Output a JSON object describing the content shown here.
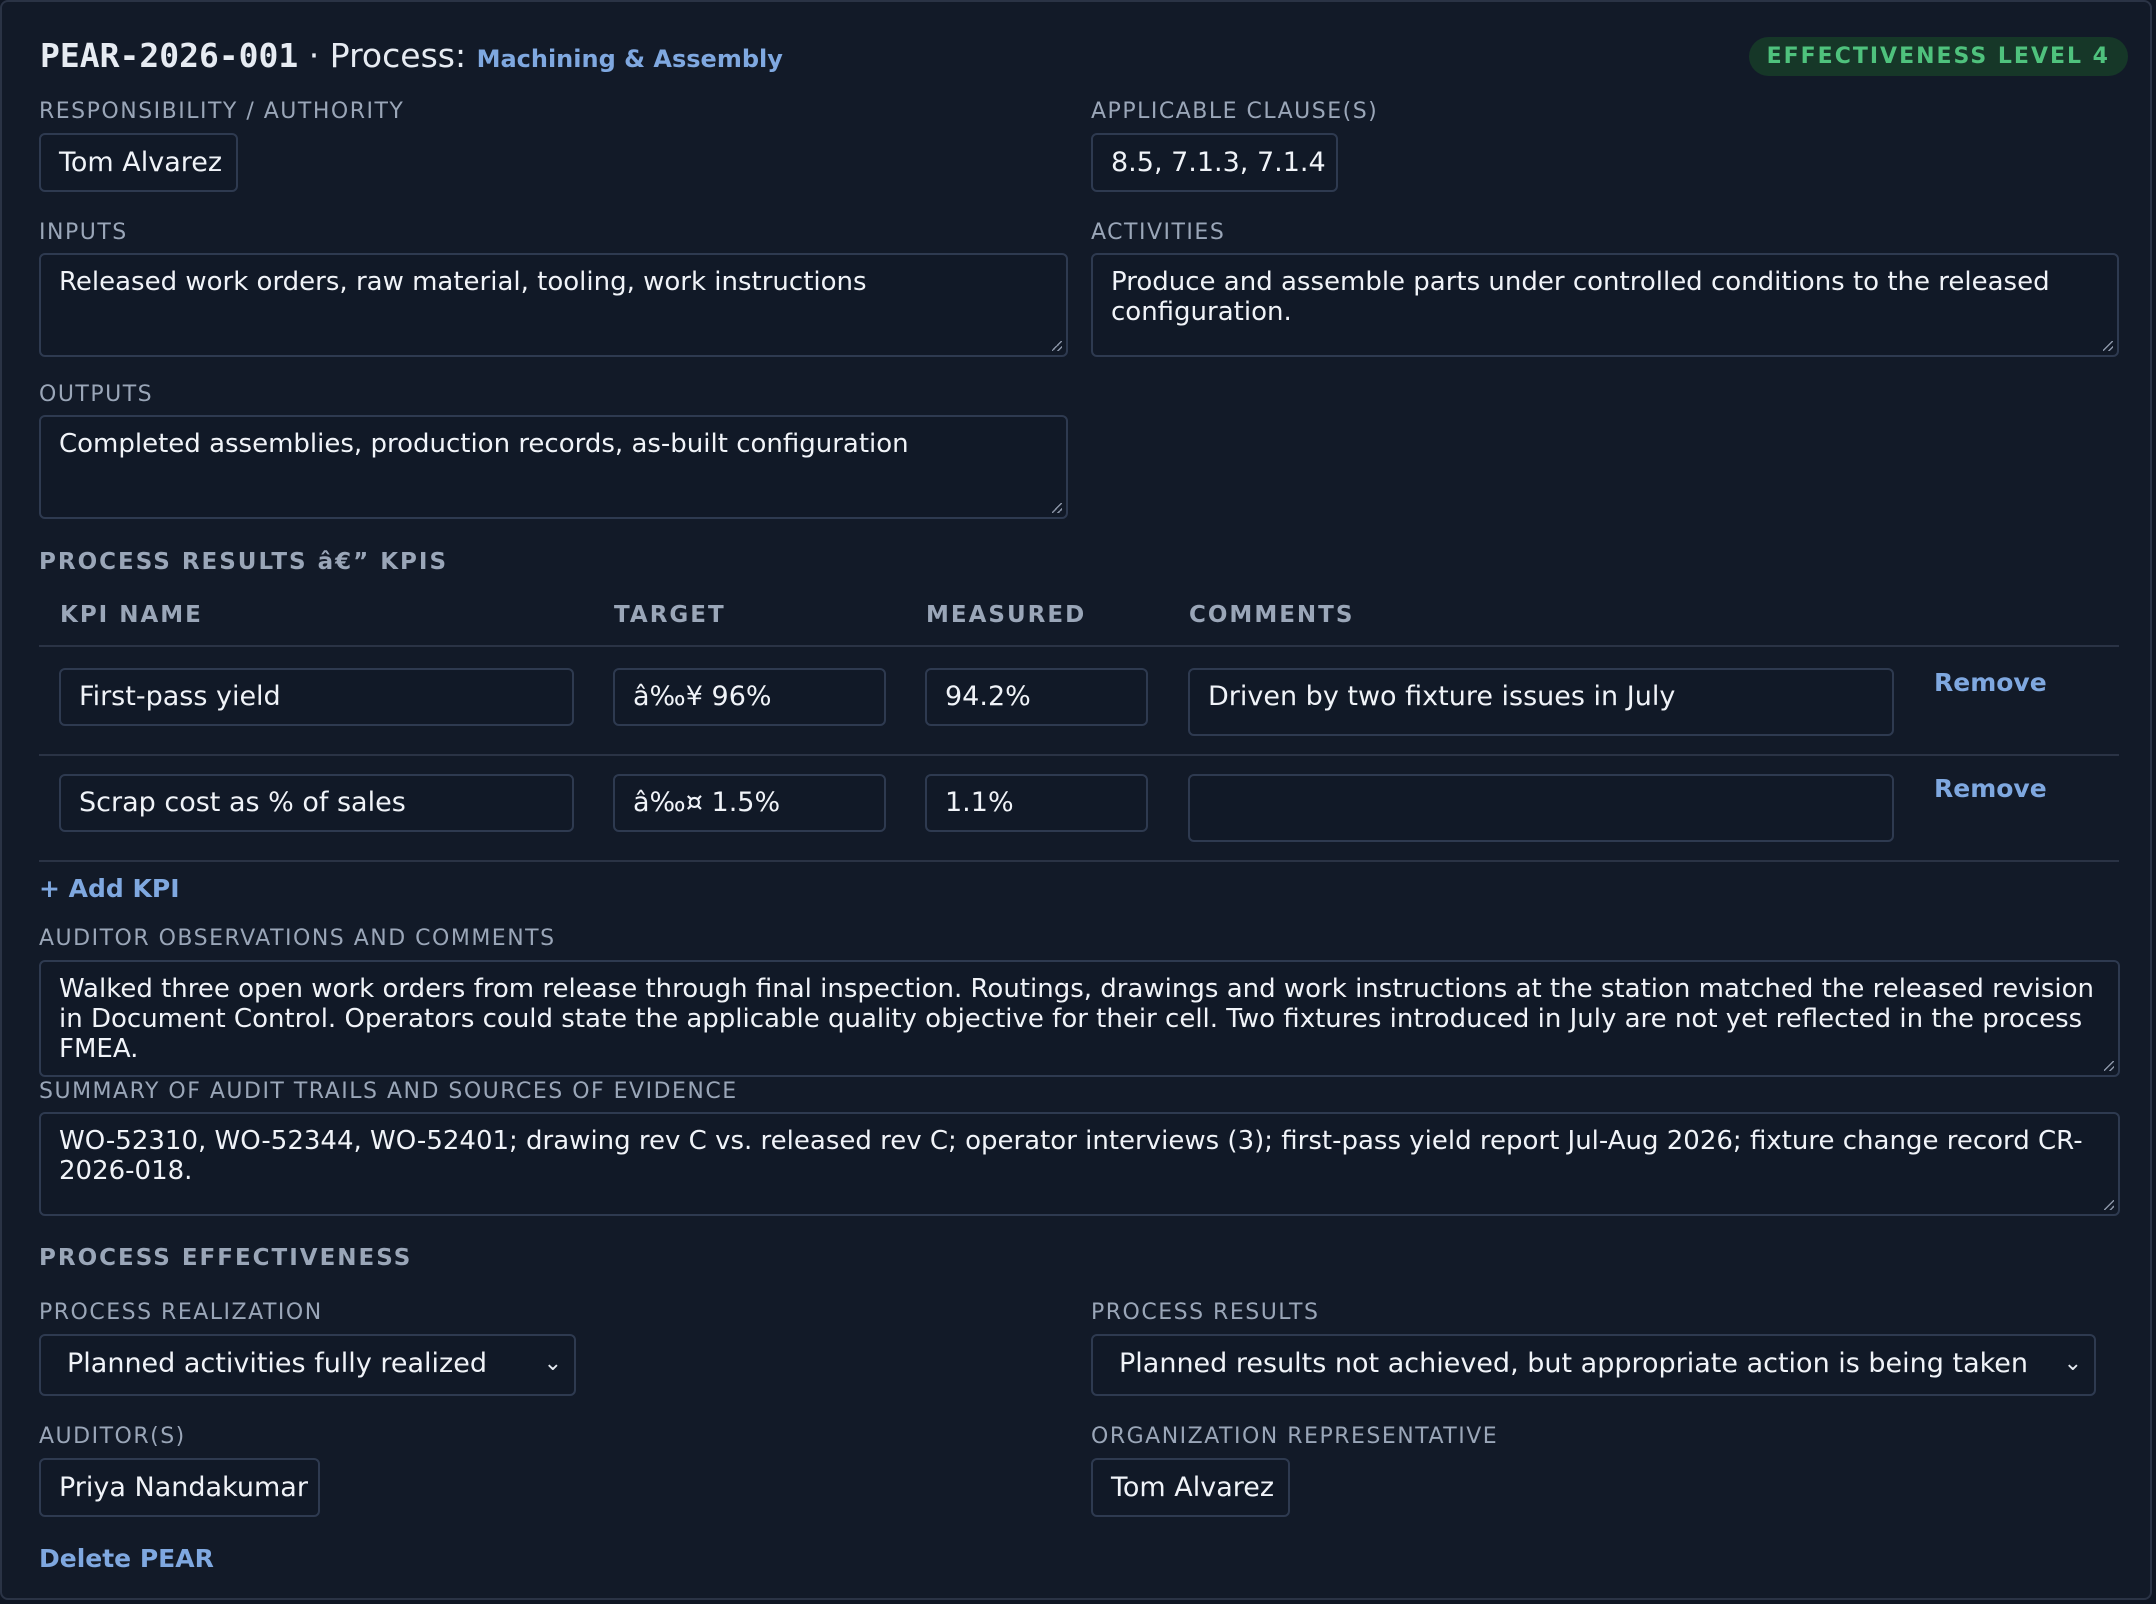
{
  "header": {
    "pear_id": "PEAR-2026-001",
    "separator": " · ",
    "process_prefix": "Process: ",
    "process_name": "Machining & Assembly",
    "badge": "EFFECTIVENESS LEVEL 4"
  },
  "fields": {
    "responsibility_label": "RESPONSIBILITY / AUTHORITY",
    "responsibility_value": "Tom Alvarez",
    "clauses_label": "APPLICABLE CLAUSE(S)",
    "clauses_value": "8.5, 7.1.3, 7.1.4",
    "inputs_label": "INPUTS",
    "inputs_value": "Released work orders, raw material, tooling, work instructions",
    "activities_label": "ACTIVITIES",
    "activities_value": "Produce and assemble parts under controlled conditions to the released configuration.",
    "outputs_label": "OUTPUTS",
    "outputs_value": "Completed assemblies, production records, as-built configuration"
  },
  "kpis": {
    "section_title": "PROCESS RESULTS â€” KPIS",
    "columns": [
      "KPI NAME",
      "TARGET",
      "MEASURED",
      "COMMENTS"
    ],
    "rows": [
      {
        "name": "First-pass yield",
        "target": "â‰¥ 96%",
        "measured": "94.2%",
        "comments": "Driven by two fixture issues in July",
        "remove": "Remove"
      },
      {
        "name": "Scrap cost as % of sales",
        "target": "â‰¤ 1.5%",
        "measured": "1.1%",
        "comments": "",
        "remove": "Remove"
      }
    ],
    "add_label": "+ Add KPI"
  },
  "observations": {
    "label": "AUDITOR OBSERVATIONS AND COMMENTS",
    "value": "Walked three open work orders from release through final inspection. Routings, drawings and work instructions at the station matched the released revision in Document Control. Operators could state the applicable quality objective for their cell. Two fixtures introduced in July are not yet reflected in the process FMEA."
  },
  "evidence": {
    "label": "SUMMARY OF AUDIT TRAILS AND SOURCES OF EVIDENCE",
    "value": "WO-52310, WO-52344, WO-52401; drawing rev C vs. released rev C; operator interviews (3); first-pass yield report Jul-Aug 2026; fixture change record CR-2026-018."
  },
  "effectiveness": {
    "section_title": "PROCESS EFFECTIVENESS",
    "realization_label": "PROCESS REALIZATION",
    "realization_value": "Planned activities fully realized",
    "results_label": "PROCESS RESULTS",
    "results_value": "Planned results not achieved, but appropriate action is being taken"
  },
  "signoff": {
    "auditors_label": "AUDITOR(S)",
    "auditors_value": "Priya Nandakumar",
    "rep_label": "ORGANIZATION REPRESENTATIVE",
    "rep_value": "Tom Alvarez",
    "delete_label": "Delete PEAR"
  }
}
